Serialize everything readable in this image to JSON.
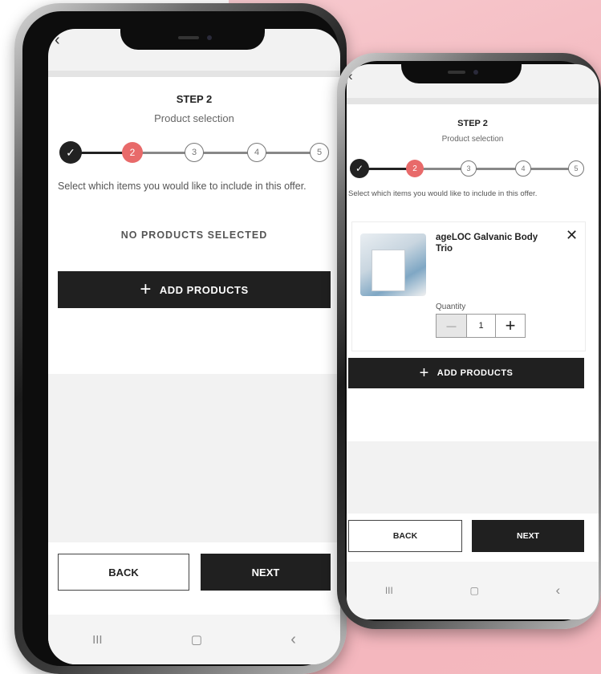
{
  "step_label": "STEP 2",
  "step_subtitle": "Product selection",
  "stepper": {
    "done_icon": "✓",
    "steps": [
      "1",
      "2",
      "3",
      "4",
      "5"
    ],
    "current": 2
  },
  "instructions": "Select which items you would like to include in this offer.",
  "empty_state": "NO PRODUCTS SELECTED",
  "add_products_label": "ADD PRODUCTS",
  "back_label": "BACK",
  "next_label": "NEXT",
  "product": {
    "name": "ageLOC Galvanic Body Trio",
    "quantity_label": "Quantity",
    "quantity": "1",
    "minus_symbol": "—",
    "plus_symbol": "+",
    "remove_symbol": "✕"
  },
  "nav": {
    "recent_symbol": "III",
    "home_symbol": "▢",
    "back_symbol": "‹"
  },
  "colors": {
    "accent_active_step": "#e86a6a",
    "dark_button": "#202020",
    "background_pink": "#f4b8bf"
  }
}
